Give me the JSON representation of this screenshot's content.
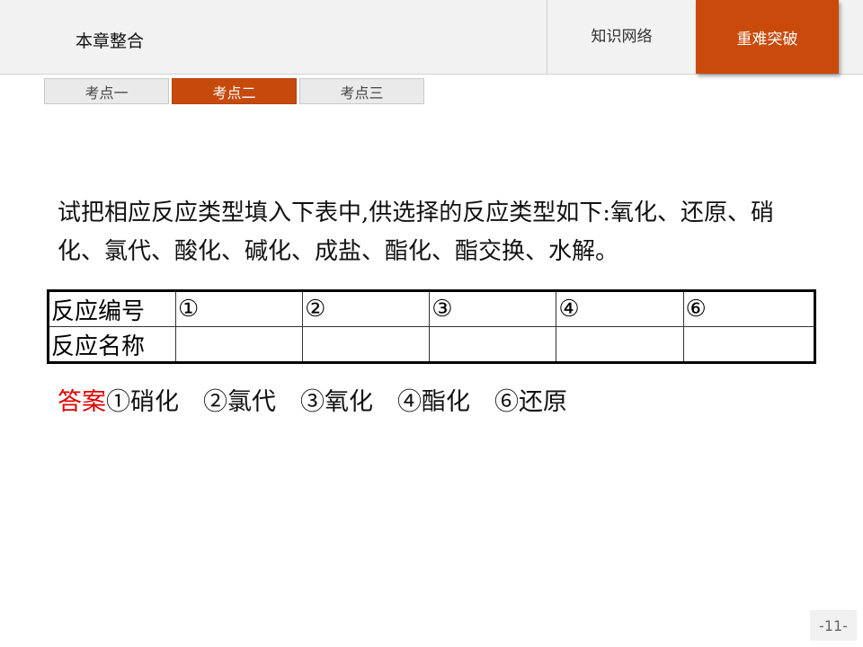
{
  "header": {
    "chapter_title": "本章整合",
    "nav": [
      {
        "label": "知识网络",
        "active": false
      },
      {
        "label": "重难突破",
        "active": true
      }
    ]
  },
  "subtabs": [
    {
      "label": "考点一",
      "active": false
    },
    {
      "label": "考点二",
      "active": true
    },
    {
      "label": "考点三",
      "active": false
    }
  ],
  "question": {
    "text": "试把相应反应类型填入下表中,供选择的反应类型如下:氧化、还原、硝化、氯代、酸化、碱化、成盐、酯化、酯交换、水解。"
  },
  "table": {
    "row1_header": "反应编号",
    "row2_header": "反应名称",
    "numbers": [
      "①",
      "②",
      "③",
      "④",
      "⑥"
    ],
    "names": [
      "",
      "",
      "",
      "",
      ""
    ]
  },
  "answer": {
    "label": "答案",
    "text": "①硝化　②氯代　③氧化　④酯化　⑥还原"
  },
  "page_number": "-11-",
  "colors": {
    "accent": "#c94a0a",
    "answer_label": "#e00000"
  }
}
